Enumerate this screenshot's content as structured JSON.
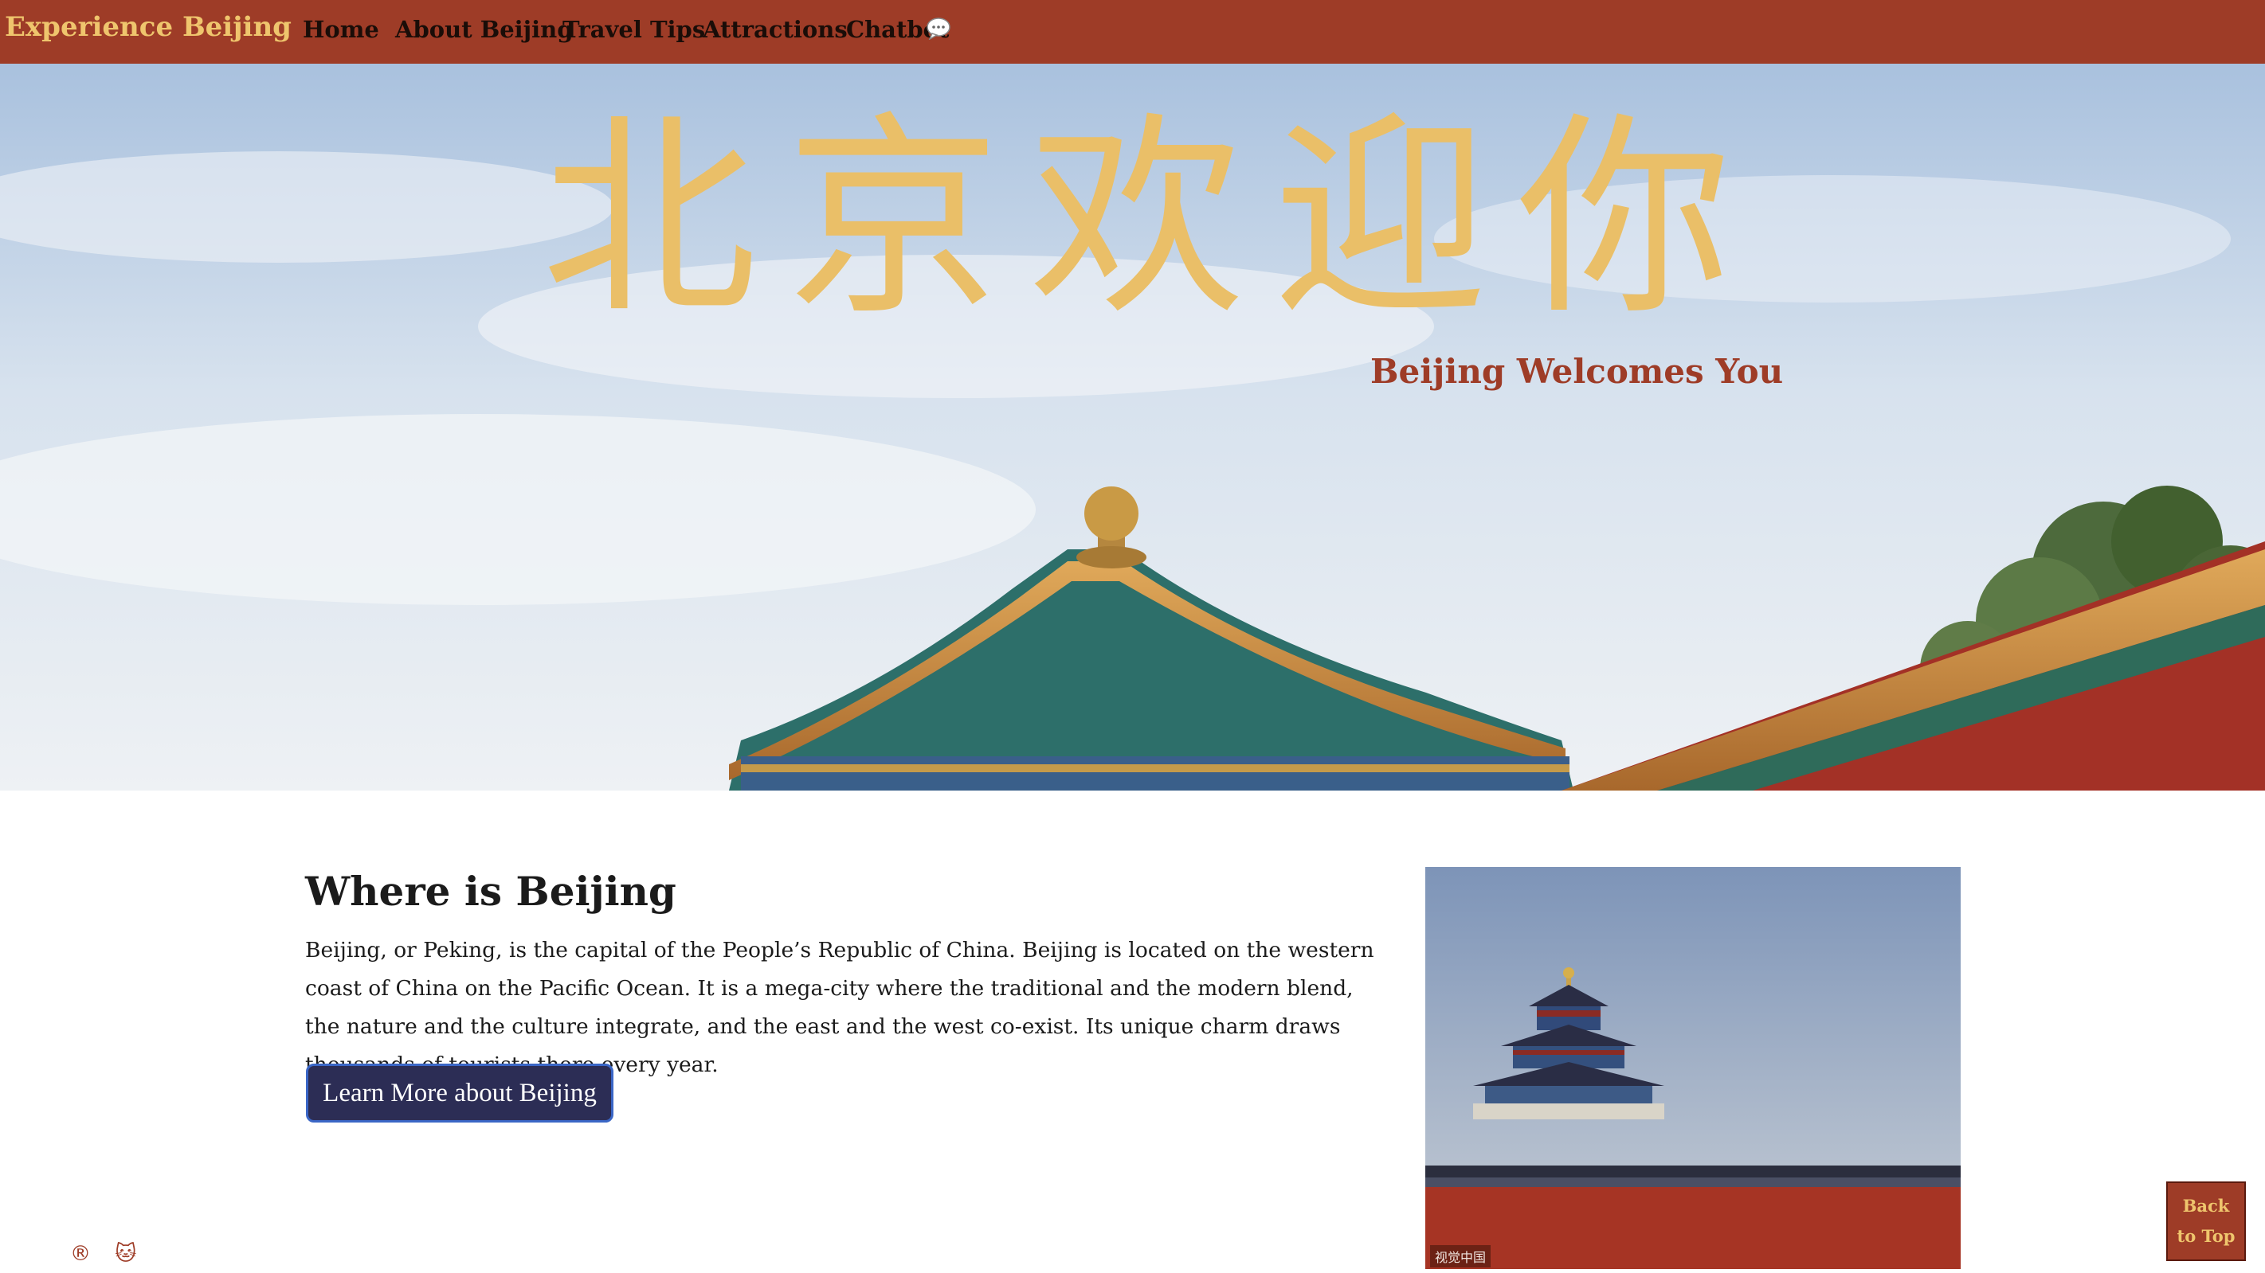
{
  "nav": {
    "brand": "Experience Beijing",
    "links": [
      "Home",
      "About Beijing",
      "Travel Tips",
      "Attractions",
      "Chatbot"
    ],
    "chat_icon": "speech-bubble-icon"
  },
  "hero": {
    "title_cn": "北京欢迎你",
    "subtitle": "Beijing Welcomes You"
  },
  "intro": {
    "heading": "Where is Beijing",
    "body": "Beijing, or Peking, is the capital of the People’s Republic of China. Beijing is located on the western coast of China on the Pacific Ocean. It is a mega-city where the traditional and the modern blend, the nature and the culture integrate, and the east and the west co-exist. Its unique charm draws thousands of tourists there every year.",
    "button": "Learn More about Beijing",
    "photo_caption": "视觉中国"
  },
  "back_to_top": {
    "line1": "Back",
    "line2": "to Top"
  },
  "footer": {
    "icon1": "®",
    "icon2": "🐱"
  },
  "colors": {
    "nav_bg": "#9e3c27",
    "accent_gold": "#efc56d",
    "button_bg": "#2c2d55"
  }
}
